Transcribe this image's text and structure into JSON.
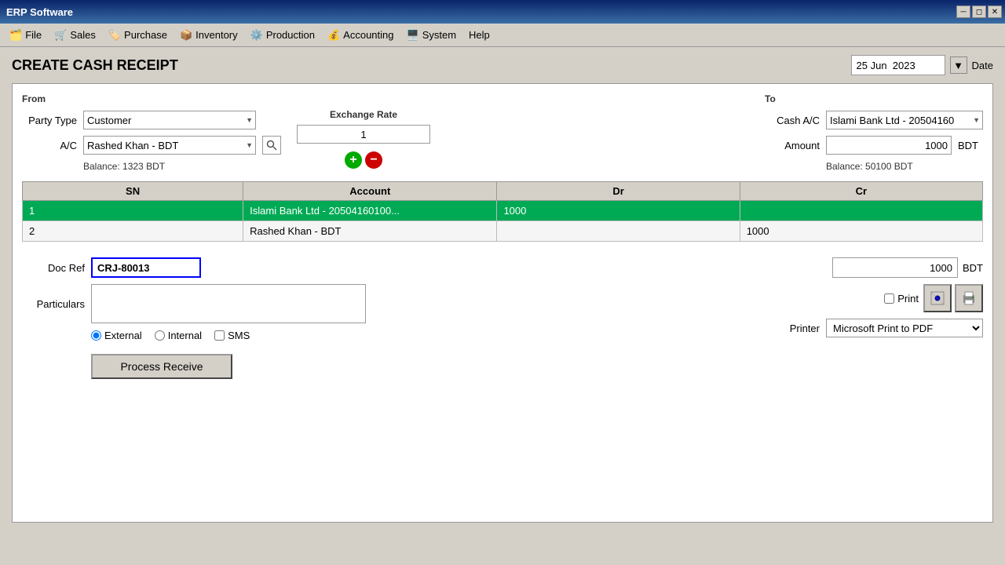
{
  "titlebar": {
    "title": "ERP Software"
  },
  "menubar": {
    "items": [
      {
        "label": "File",
        "icon": "📁"
      },
      {
        "label": "Sales",
        "icon": "🛒"
      },
      {
        "label": "Purchase",
        "icon": "🏷️"
      },
      {
        "label": "Inventory",
        "icon": "📦"
      },
      {
        "label": "Production",
        "icon": "⚙️"
      },
      {
        "label": "Accounting",
        "icon": "💰"
      },
      {
        "label": "System",
        "icon": "🖥️"
      },
      {
        "label": "Help",
        "icon": ""
      }
    ]
  },
  "page": {
    "title": "CREATE CASH RECEIPT",
    "date_label": "Date",
    "date_value": "25 Jun  2023"
  },
  "form": {
    "from_label": "From",
    "to_label": "To",
    "party_type_label": "Party Type",
    "party_type_value": "Customer",
    "ac_label": "A/C",
    "ac_value": "Rashed Khan - BDT",
    "balance_text": "Balance: 1323 BDT",
    "exchange_rate_label": "Exchange Rate",
    "exchange_rate_value": "1",
    "cash_ac_label": "Cash A/C",
    "cash_ac_value": "Islami Bank Ltd - 20504160",
    "amount_label": "Amount",
    "amount_value": "1000",
    "amount_currency": "BDT",
    "balance_to_text": "Balance: 50100 BDT"
  },
  "table": {
    "columns": [
      "SN",
      "Account",
      "Dr",
      "Cr"
    ],
    "rows": [
      {
        "sn": "1",
        "account": "Islami Bank Ltd - 20504160100...",
        "dr": "1000",
        "cr": "",
        "selected": true
      },
      {
        "sn": "2",
        "account": "Rashed Khan - BDT",
        "dr": "",
        "cr": "1000",
        "selected": false
      }
    ]
  },
  "bottom": {
    "doc_ref_label": "Doc Ref",
    "doc_ref_value": "CRJ-80013",
    "particulars_label": "Particulars",
    "particulars_value": "",
    "radio_external": "External",
    "radio_internal": "Internal",
    "checkbox_sms": "SMS",
    "process_btn_label": "Process Receive",
    "total_value": "1000",
    "total_currency": "BDT",
    "print_label": "Print",
    "printer_label": "Printer",
    "printer_value": "Microsoft Print to PDF"
  }
}
